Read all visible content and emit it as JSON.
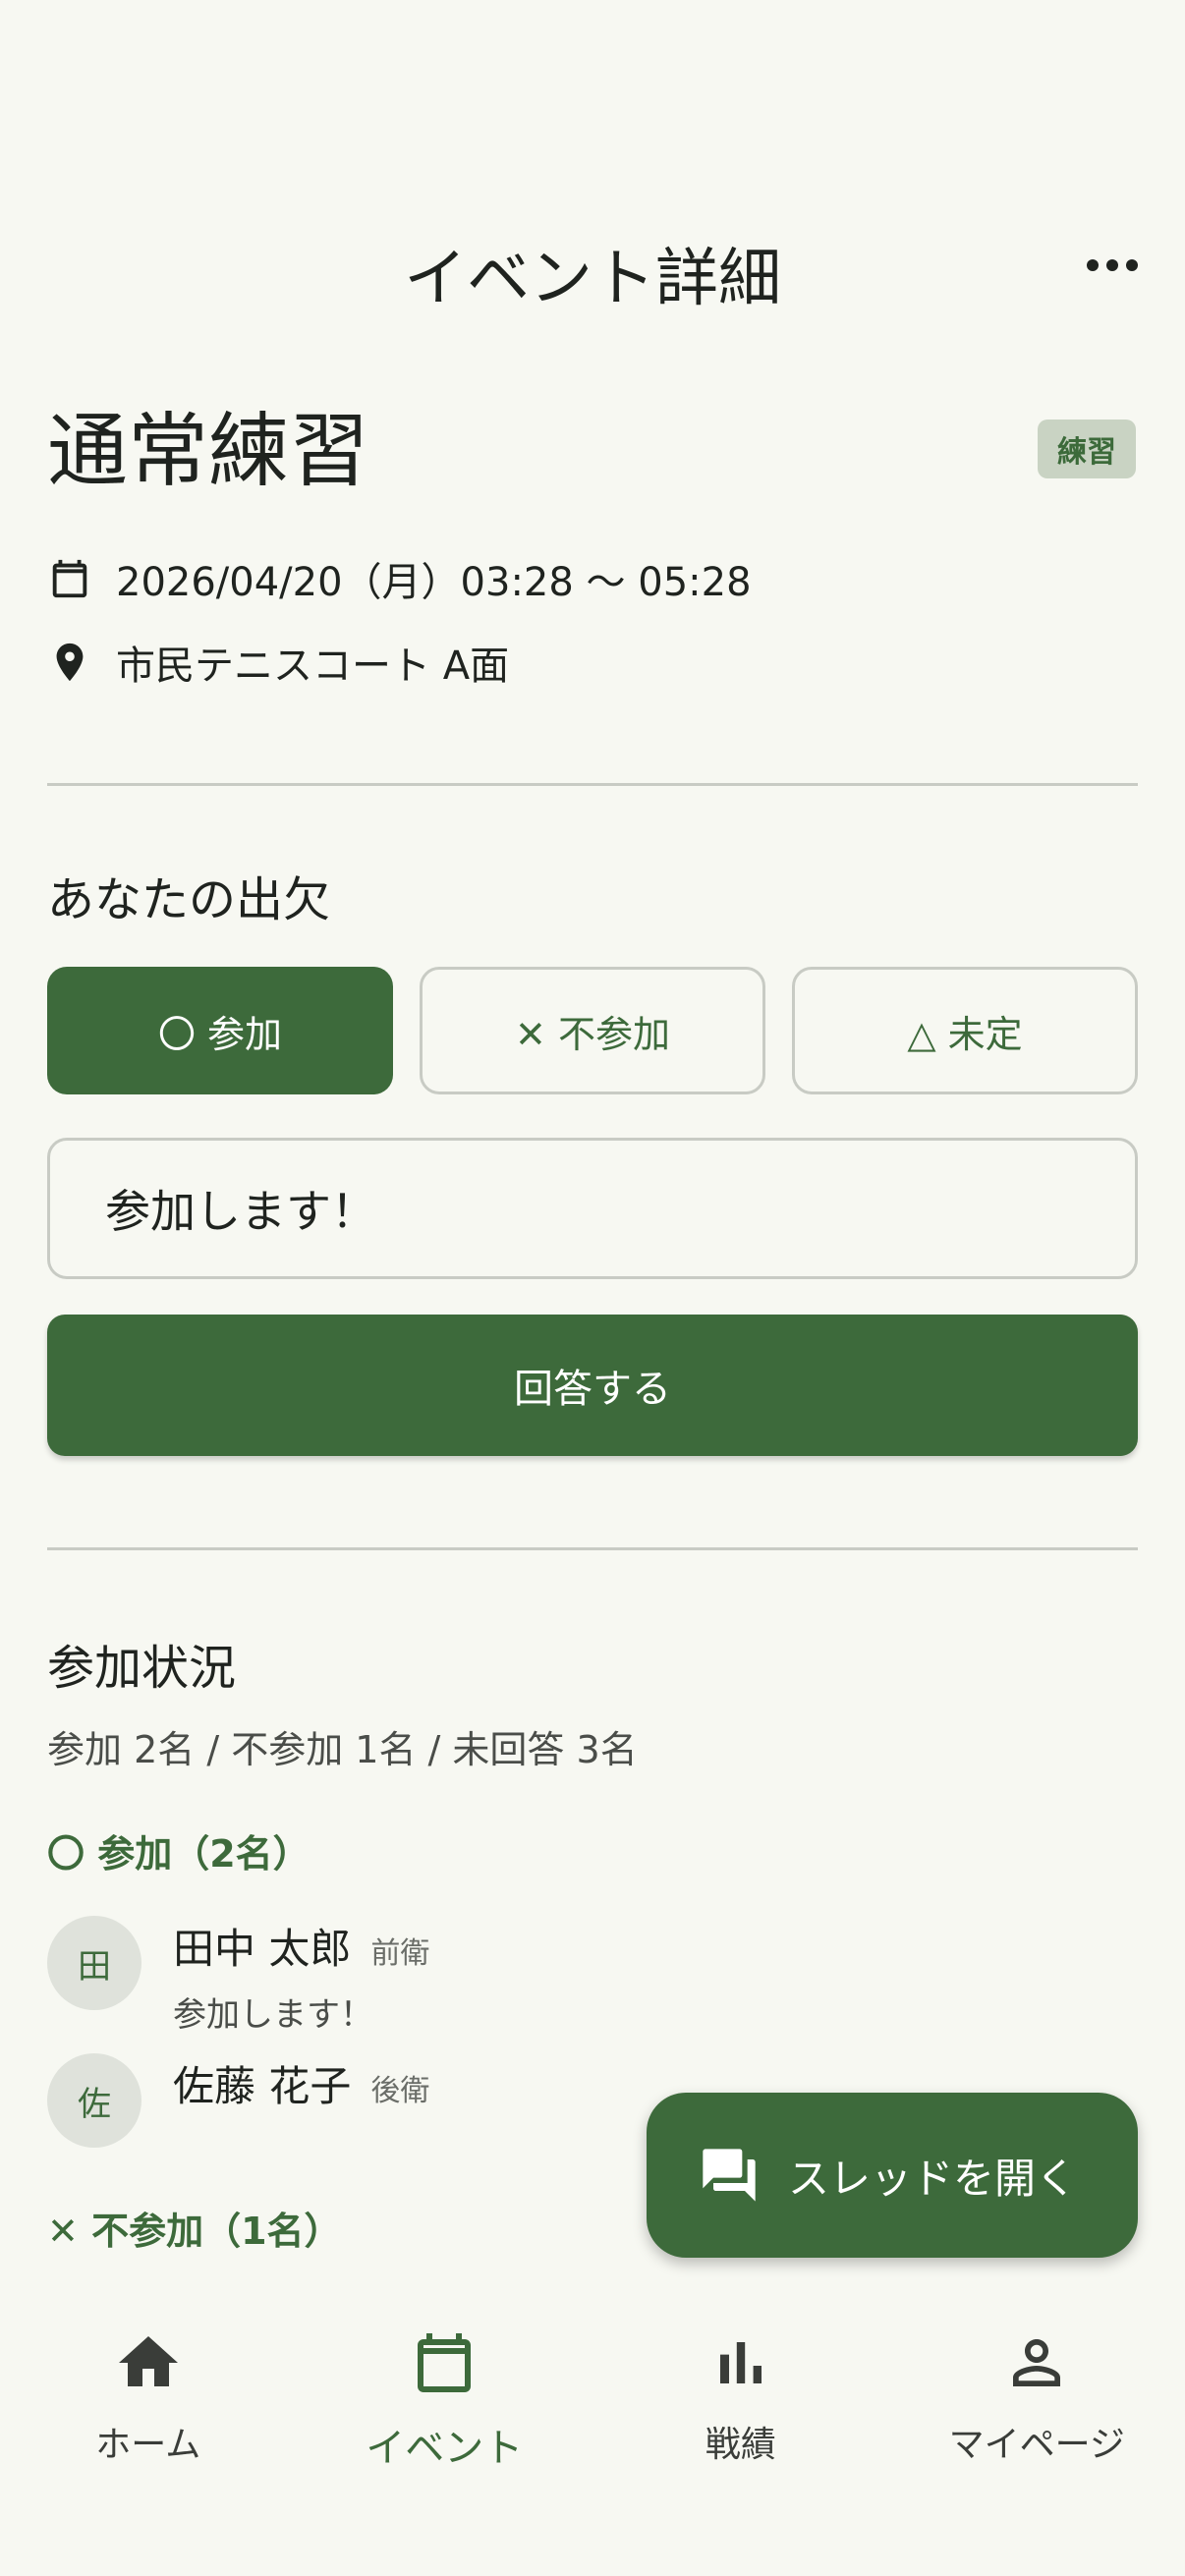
{
  "header": {
    "title": "イベント詳細"
  },
  "event": {
    "title": "通常練習",
    "type_badge": "練習",
    "datetime": "2026/04/20（月）03:28 〜 05:28",
    "location": "市民テニスコート A面"
  },
  "attendance": {
    "section_title": "あなたの出欠",
    "options": [
      {
        "label": "〇 参加",
        "selected": true
      },
      {
        "label": "✕ 不参加",
        "selected": false
      },
      {
        "label": "△ 未定",
        "selected": false
      }
    ],
    "comment_value": "参加します！",
    "submit_label": "回答する"
  },
  "status": {
    "section_title": "参加状況",
    "summary": "参加 2名 / 不参加 1名 / 未回答 3名",
    "groups": [
      {
        "title": "〇 参加（2名）",
        "members": [
          {
            "initial": "田",
            "name": "田中 太郎",
            "position": "前衛",
            "comment": "参加します！"
          },
          {
            "initial": "佐",
            "name": "佐藤 花子",
            "position": "後衛"
          }
        ]
      },
      {
        "title": "✕ 不参加（1名）"
      }
    ]
  },
  "fab": {
    "label": "スレッドを開く",
    "icon": "forum-icon"
  },
  "bottom_nav": {
    "items": [
      {
        "label": "ホーム",
        "icon": "home-icon"
      },
      {
        "label": "イベント",
        "icon": "calendar-icon",
        "active": true
      },
      {
        "label": "戦績",
        "icon": "bar-chart-icon"
      },
      {
        "label": "マイページ",
        "icon": "person-icon"
      }
    ]
  },
  "colors": {
    "accent": "#3d6a3b",
    "background": "#f7f8f2",
    "badge_bg": "#c9d3c3",
    "divider": "#c8cbc4"
  }
}
